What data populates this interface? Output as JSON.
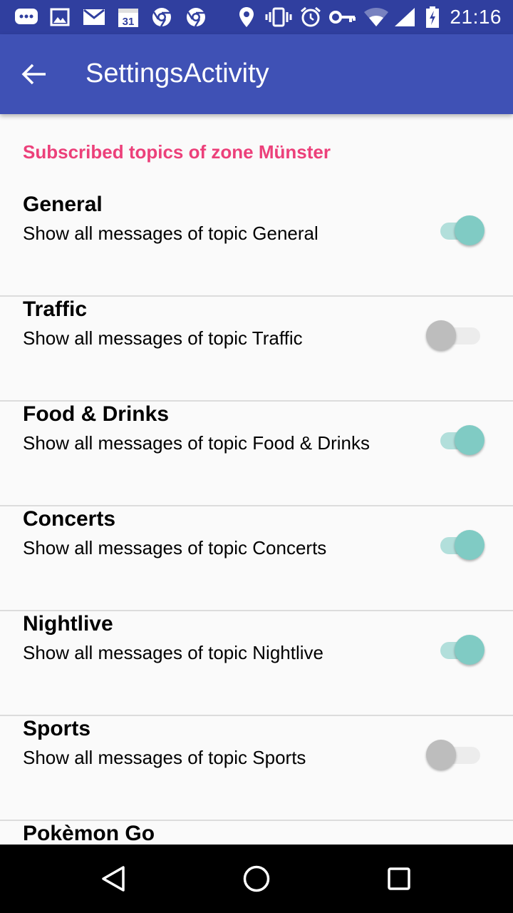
{
  "status_bar": {
    "time": "21:16",
    "calendar_day": "31",
    "icons": [
      "messaging-icon",
      "gallery-icon",
      "gmail-icon",
      "calendar-icon",
      "chrome-icon",
      "chrome-icon",
      "location-icon",
      "vibrate-icon",
      "alarm-icon",
      "vpn-key-icon",
      "wifi-icon",
      "signal-icon",
      "battery-charging-icon"
    ]
  },
  "app_bar": {
    "title": "SettingsActivity",
    "background": "#3f51b5",
    "status_background": "#303f9f"
  },
  "category": {
    "title": "Subscribed topics of zone Münster",
    "color": "#ec407a"
  },
  "topics": [
    {
      "title": "General",
      "summary": "Show all messages of topic General",
      "enabled": true
    },
    {
      "title": "Traffic",
      "summary": "Show all messages of topic Traffic",
      "enabled": false
    },
    {
      "title": "Food & Drinks",
      "summary": "Show all messages of topic Food & Drinks",
      "enabled": true
    },
    {
      "title": "Concerts",
      "summary": "Show all messages of topic Concerts",
      "enabled": true
    },
    {
      "title": "Nightlive",
      "summary": "Show all messages of topic Nightlive",
      "enabled": true
    },
    {
      "title": "Sports",
      "summary": "Show all messages of topic Sports",
      "enabled": false
    },
    {
      "title": "Pokèmon Go",
      "summary": "",
      "enabled": false
    }
  ],
  "switch_colors": {
    "on_thumb": "#80cbc4",
    "on_track": "#b2dfdb",
    "off_thumb": "#bdbdbd",
    "off_track": "#ececec"
  },
  "nav_bar": {
    "icons": [
      "back-triangle-icon",
      "home-circle-icon",
      "recents-square-icon"
    ]
  }
}
